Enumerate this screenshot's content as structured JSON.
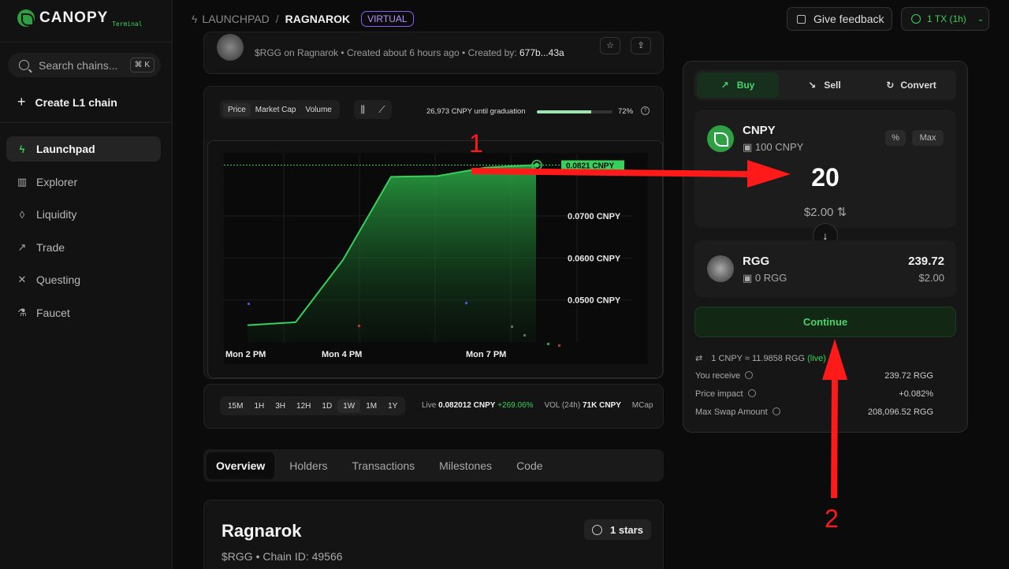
{
  "app": {
    "name": "CANOPY",
    "sub": "Terminal"
  },
  "search": {
    "placeholder": "Search chains...",
    "shortcut": "⌘ K"
  },
  "sidebar": {
    "create_label": "Create L1 chain",
    "items": [
      {
        "label": "Launchpad",
        "icon": "bolt-icon",
        "active": true
      },
      {
        "label": "Explorer",
        "icon": "bar-chart-icon"
      },
      {
        "label": "Liquidity",
        "icon": "droplet-icon"
      },
      {
        "label": "Trade",
        "icon": "trending-up-icon"
      },
      {
        "label": "Questing",
        "icon": "swords-icon"
      },
      {
        "label": "Faucet",
        "icon": "flask-icon"
      }
    ]
  },
  "header": {
    "breadcrumb_root": "LAUNCHPAD",
    "breadcrumb_current": "RAGNAROK",
    "badge": "VIRTUAL",
    "feedback_label": "Give feedback",
    "tx_label": "1 TX (1h)"
  },
  "token": {
    "symbol_on_chain": "$RGG on Ragnarok",
    "created": "Created about 6 hours ago",
    "created_by_label": "Created by:",
    "creator": "677b...43a"
  },
  "chart_controls": {
    "tabs": [
      "Price",
      "Market Cap",
      "Volume"
    ],
    "graduation_text": "26,973 CNPY until graduation",
    "graduation_pct": "72%",
    "graduation_fraction": 0.72
  },
  "chart_data": {
    "type": "area",
    "x_labels": [
      "Mon 2 PM",
      "Mon 4 PM",
      "Mon 7 PM"
    ],
    "y_tick_labels": [
      "0.0700 CNPY",
      "0.0600 CNPY",
      "0.0500 CNPY"
    ],
    "current_label": "0.0821 CNPY",
    "series": [
      {
        "values": [
          0.044,
          0.0447,
          0.0595,
          0.0793,
          0.0795,
          0.0815,
          0.0821,
          0.0821
        ]
      }
    ],
    "ylim": [
      0.04,
      0.085
    ],
    "color": "#37d05b"
  },
  "timeframes": {
    "options": [
      "15M",
      "1H",
      "3H",
      "12H",
      "1D",
      "1W",
      "1M",
      "1Y"
    ],
    "active": "1W",
    "live_label": "Live",
    "live_value": "0.082012 CNPY",
    "live_change": "+269.06%",
    "vol_label": "VOL (24h)",
    "vol_value": "71K CNPY",
    "mcap_label": "MCap"
  },
  "main_tabs": [
    "Overview",
    "Holders",
    "Transactions",
    "Milestones",
    "Code"
  ],
  "overview": {
    "title": "Ragnarok",
    "subtitle": "$RGG • Chain ID: 49566",
    "stars": "1 stars"
  },
  "swap": {
    "tabs": [
      "Buy",
      "Sell",
      "Convert"
    ],
    "from": {
      "symbol": "CNPY",
      "balance": "100 CNPY",
      "amount": "20",
      "usd": "$2.00",
      "pct_label": "%",
      "max_label": "Max"
    },
    "to": {
      "symbol": "RGG",
      "balance": "0 RGG",
      "amount": "239.72",
      "usd": "$2.00"
    },
    "continue_label": "Continue",
    "rate": "1 CNPY ≈ 11.9858 RGG",
    "rate_live": "(live)",
    "receive_label": "You receive",
    "receive_value": "239.72 RGG",
    "impact_label": "Price impact",
    "impact_value": "+0.082%",
    "max_swap_label": "Max Swap Amount",
    "max_swap_value": "208,096.52 RGG"
  },
  "annotations": [
    "1",
    "2"
  ]
}
